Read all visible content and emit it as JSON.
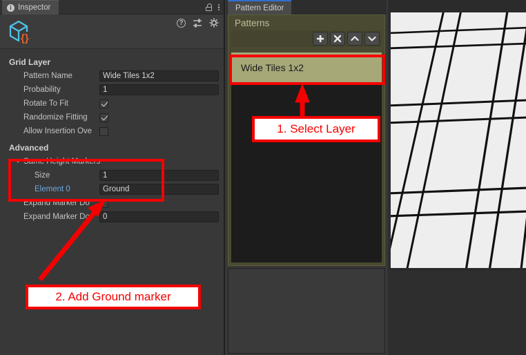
{
  "inspector": {
    "tab_label": "Inspector",
    "tab_icon": "info-icon",
    "lock_icon": "lock-icon",
    "menu_icon": "kebab-menu-icon",
    "object_icon": "scriptable-object-cube-icon",
    "help_icon": "help-icon",
    "preset_icon": "preset-sliders-icon",
    "settings_icon": "gear-icon",
    "sections": [
      {
        "title": "Grid Layer",
        "rows": [
          {
            "label": "Pattern Name",
            "type": "text",
            "value": "Wide Tiles 1x2"
          },
          {
            "label": "Probability",
            "type": "text",
            "value": "1"
          },
          {
            "label": "Rotate To Fit",
            "type": "checkbox",
            "checked": true
          },
          {
            "label": "Randomize Fitting",
            "type": "checkbox",
            "checked": true
          },
          {
            "label": "Allow Insertion Ove",
            "type": "checkbox",
            "checked": false
          }
        ]
      },
      {
        "title": "Advanced",
        "rows": [
          {
            "label": "Same Height Markers",
            "type": "foldout"
          },
          {
            "label": "Size",
            "type": "text",
            "value": "1"
          },
          {
            "label": "Element 0",
            "type": "text",
            "value": "Ground"
          },
          {
            "label": "Expand Marker Do",
            "type": "checkbox",
            "checked": false
          },
          {
            "label": "Expand Marker Do",
            "type": "text",
            "value": "0"
          }
        ]
      }
    ]
  },
  "pattern_editor": {
    "tab_label": "Pattern Editor",
    "header": "Patterns",
    "buttons": [
      {
        "name": "add-pattern-button",
        "icon": "plus-icon"
      },
      {
        "name": "delete-pattern-button",
        "icon": "close-x-icon"
      },
      {
        "name": "move-up-button",
        "icon": "chevron-up-icon"
      },
      {
        "name": "move-down-button",
        "icon": "chevron-down-icon"
      }
    ],
    "items": [
      {
        "label": "Wide Tiles 1x2",
        "selected": true
      }
    ]
  },
  "annotations": [
    {
      "text": "1. Select Layer"
    },
    {
      "text": "2. Add Ground marker"
    }
  ],
  "colors": {
    "annotation_red": "#f50000",
    "selection_olive": "#a6a878",
    "panel_olive": "#4a4a32",
    "tab_accent_blue": "#2f6fd0",
    "link_blue": "#6fa8dc"
  }
}
